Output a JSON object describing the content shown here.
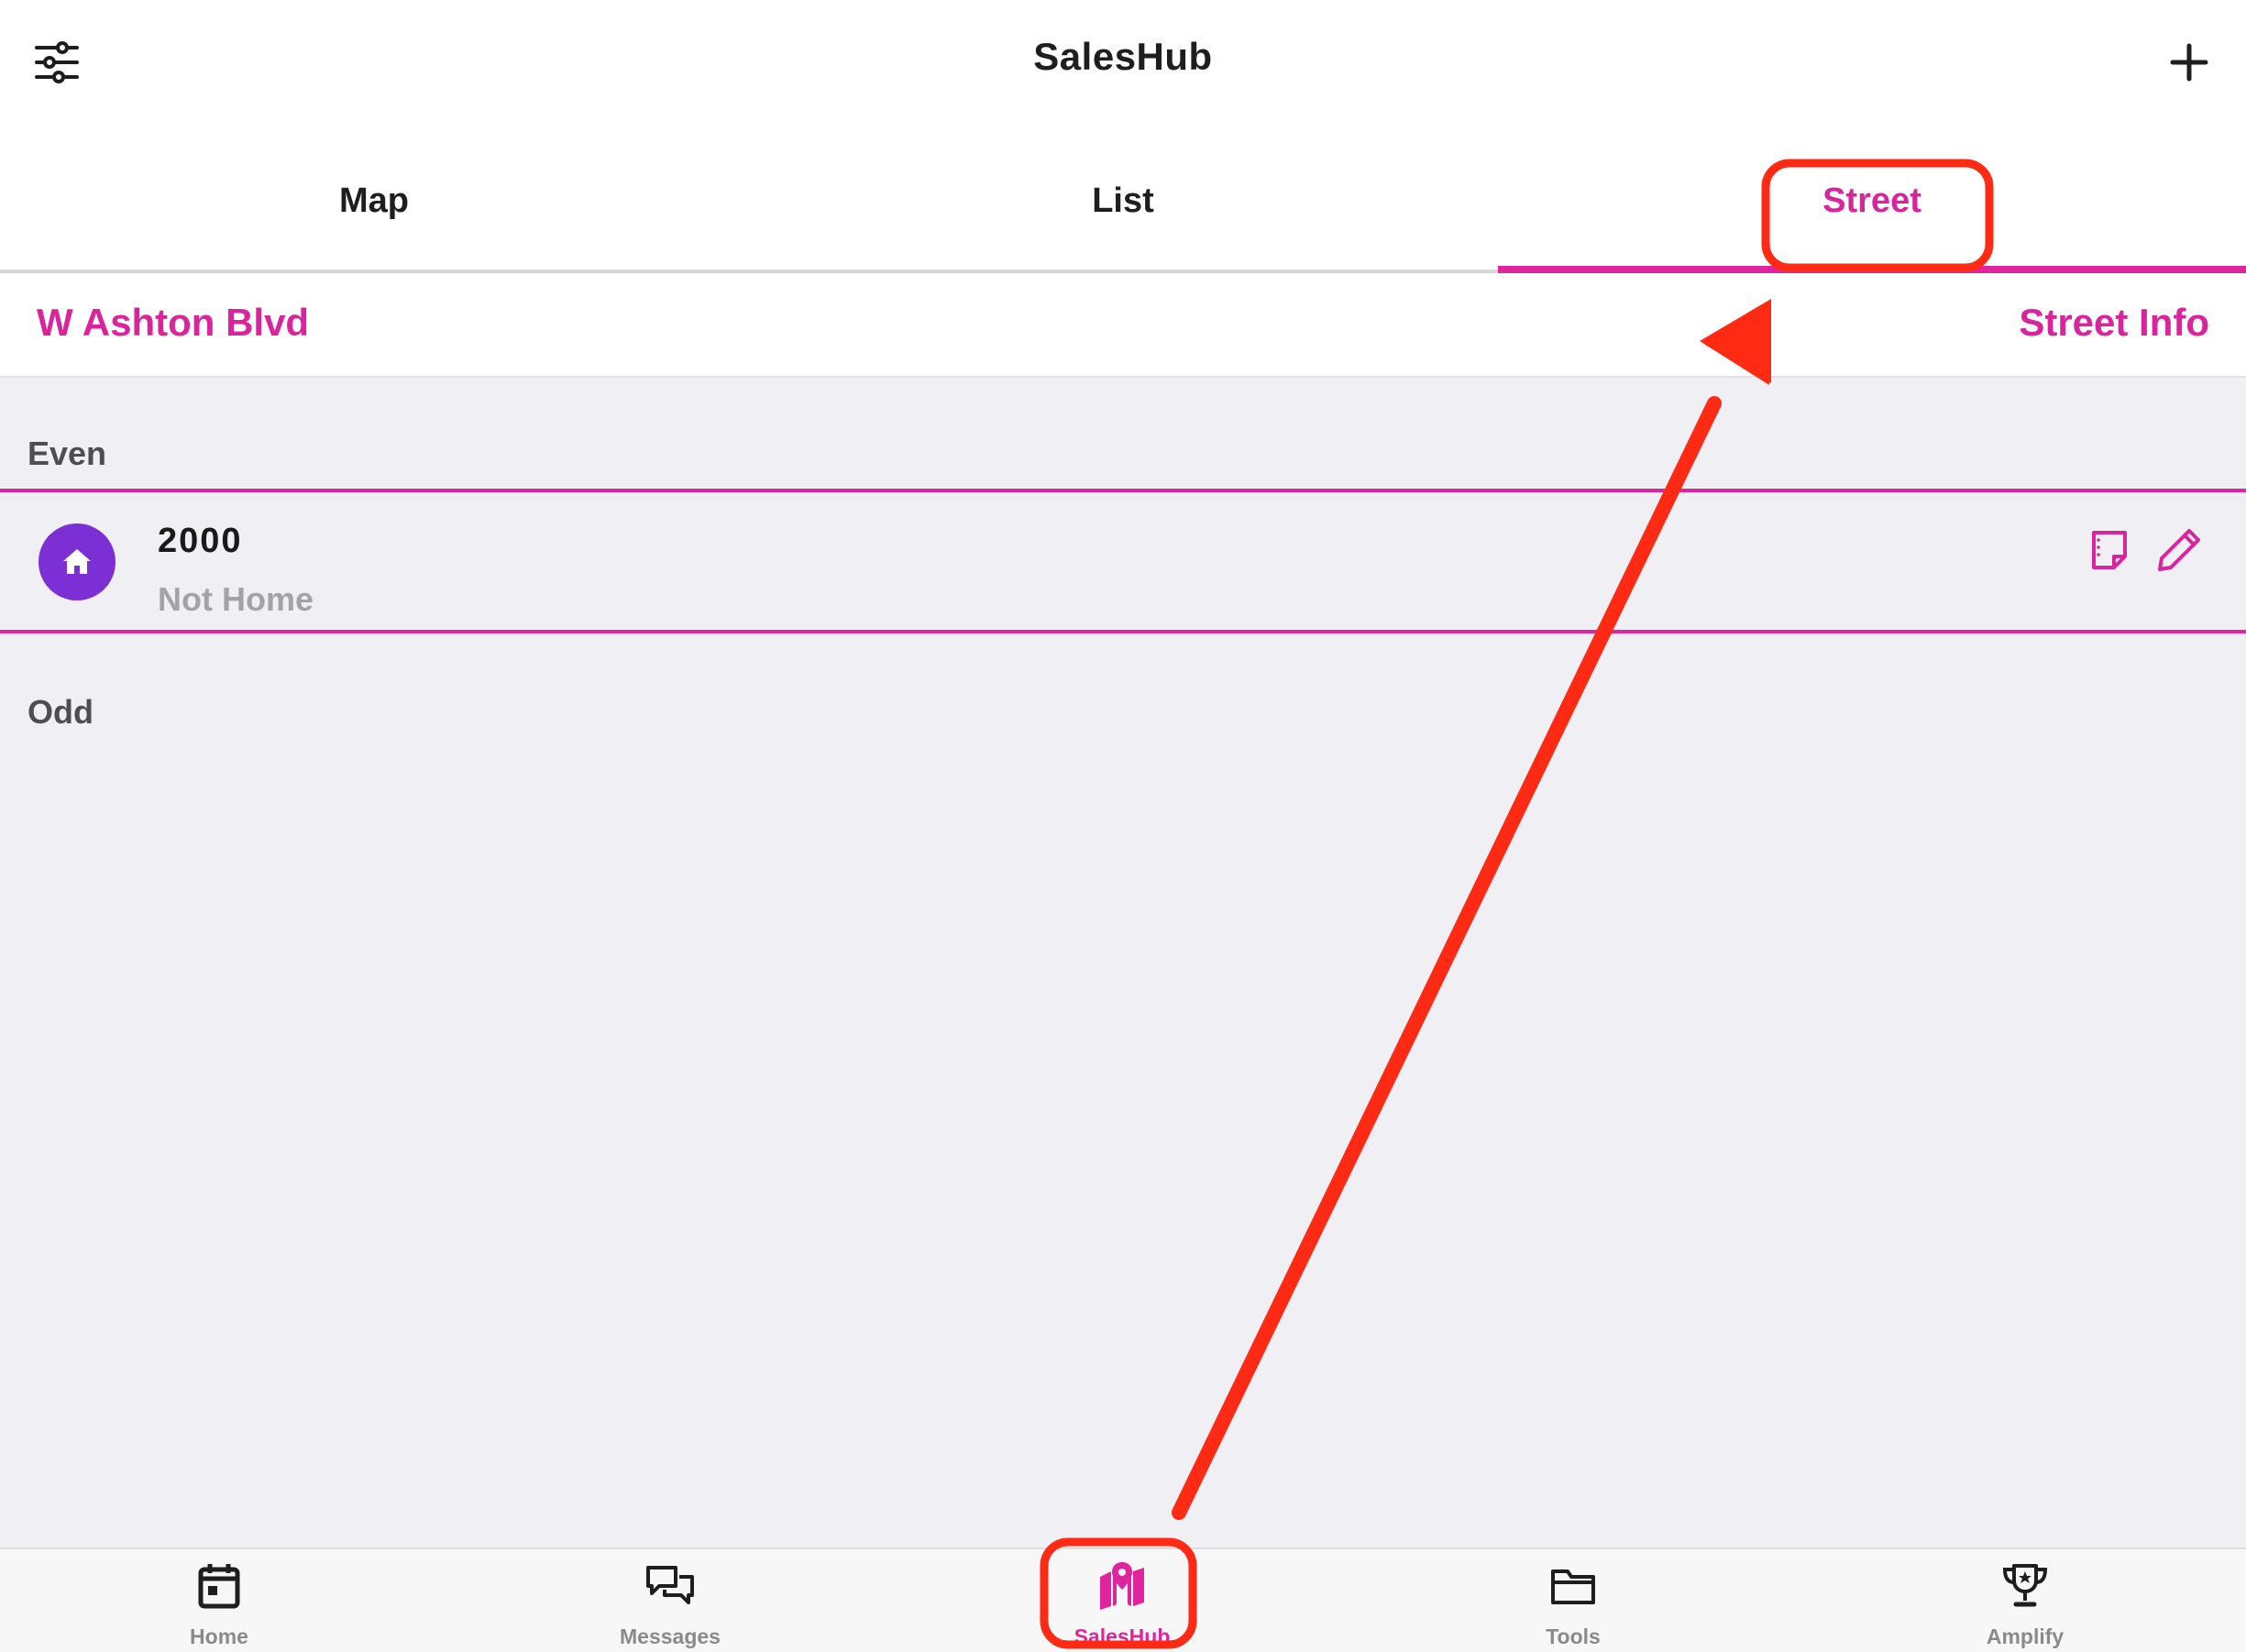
{
  "app": {
    "title": "SalesHub"
  },
  "tabs": [
    {
      "label": "Map"
    },
    {
      "label": "List"
    },
    {
      "label": "Street",
      "active": true
    }
  ],
  "street": {
    "name": "W Ashton Blvd",
    "info_label": "Street Info"
  },
  "sections": {
    "even": {
      "header": "Even",
      "items": [
        {
          "number": "2000",
          "status": "Not Home"
        }
      ]
    },
    "odd": {
      "header": "Odd",
      "items": []
    }
  },
  "bottom_nav": [
    {
      "label": "Home",
      "icon": "calendar-icon"
    },
    {
      "label": "Messages",
      "icon": "chat-bubbles-icon"
    },
    {
      "label": "SalesHub",
      "icon": "map-pin-icon",
      "active": true
    },
    {
      "label": "Tools",
      "icon": "folder-icon"
    },
    {
      "label": "Amplify",
      "icon": "trophy-icon"
    }
  ],
  "colors": {
    "accent": "#e0249e",
    "avatar": "#7b2fd4",
    "annotation": "#ff2a14"
  }
}
